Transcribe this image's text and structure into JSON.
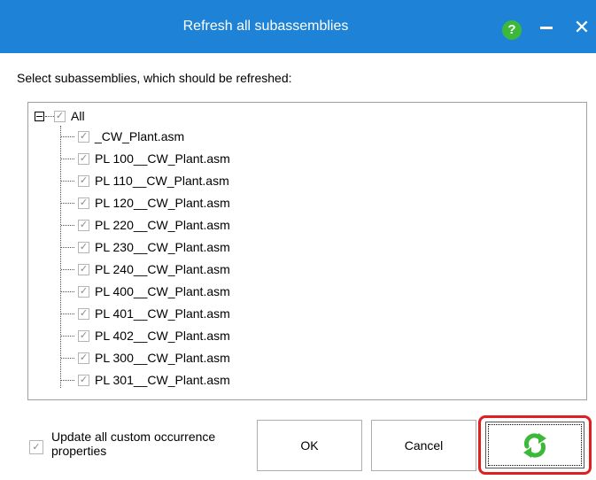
{
  "window": {
    "title": "Refresh all subassemblies",
    "help_glyph": "?",
    "close_glyph": "✕"
  },
  "prompt": "Select subassemblies, which should be refreshed:",
  "tree": {
    "root": {
      "label": "All",
      "checked": true
    },
    "items": [
      {
        "label": "_CW_Plant.asm",
        "checked": true
      },
      {
        "label": "PL 100__CW_Plant.asm",
        "checked": true
      },
      {
        "label": "PL 110__CW_Plant.asm",
        "checked": true
      },
      {
        "label": "PL 120__CW_Plant.asm",
        "checked": true
      },
      {
        "label": "PL 220__CW_Plant.asm",
        "checked": true
      },
      {
        "label": "PL 230__CW_Plant.asm",
        "checked": true
      },
      {
        "label": "PL 240__CW_Plant.asm",
        "checked": true
      },
      {
        "label": "PL 400__CW_Plant.asm",
        "checked": true
      },
      {
        "label": "PL 401__CW_Plant.asm",
        "checked": true
      },
      {
        "label": "PL 402__CW_Plant.asm",
        "checked": true
      },
      {
        "label": "PL 300__CW_Plant.asm",
        "checked": true
      },
      {
        "label": "PL 301__CW_Plant.asm",
        "checked": true
      }
    ]
  },
  "options": {
    "update_custom_label": "Update all custom occurrence properties",
    "update_custom_checked": true
  },
  "buttons": {
    "ok": "OK",
    "cancel": "Cancel",
    "refresh_icon": "refresh-arrows-icon"
  },
  "colors": {
    "titlebar": "#1e83d6",
    "help": "#3cb93a",
    "highlight": "#e02020",
    "refresh_green": "#3cb93a"
  }
}
